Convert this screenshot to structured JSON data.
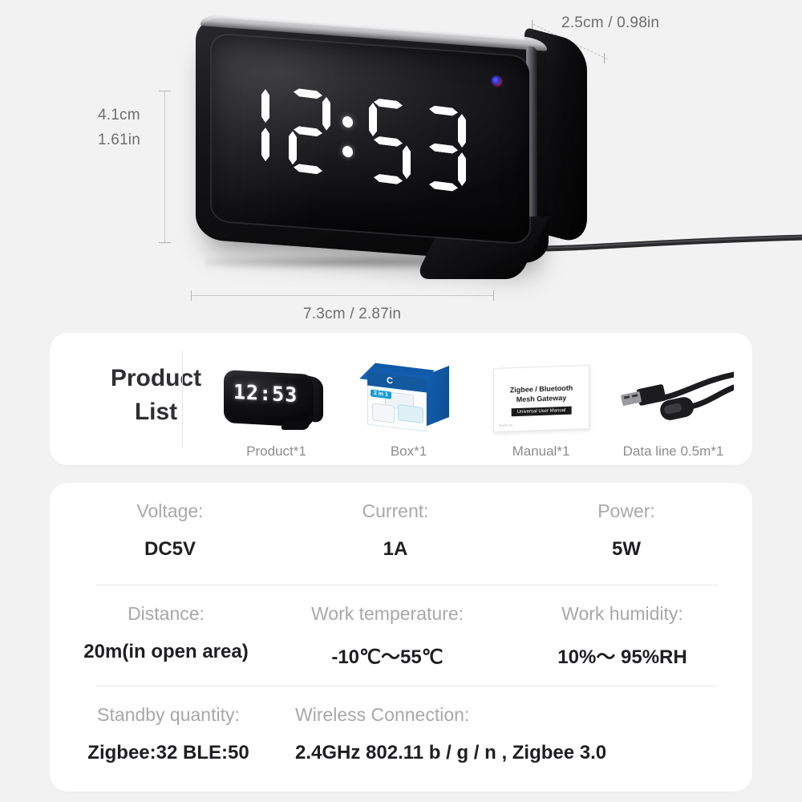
{
  "dimensions": {
    "height_label": "4.1cm",
    "height_label_in": "1.61in",
    "depth_label": "2.5cm / 0.98in",
    "width_label": "7.3cm / 2.87in"
  },
  "device": {
    "time_display": "12:53",
    "time_digits": [
      "1",
      "2",
      "5",
      "3"
    ],
    "led_indicator": "status-led"
  },
  "product_list": {
    "title_line1": "Product",
    "title_line2": "List",
    "items": [
      {
        "label": "Product*1",
        "icon": "clock-device-thumb",
        "time": "12:53"
      },
      {
        "label": "Box*1",
        "icon": "retail-box-thumb",
        "badge": "2 in 1",
        "logo": "C"
      },
      {
        "label": "Manual*1",
        "icon": "manual-booklet-thumb",
        "cover_title_line1": "Zigbee / Bluetooth",
        "cover_title_line2": "Mesh Gateway",
        "cover_badge": "Universal User Manual",
        "cover_small": "Model No."
      },
      {
        "label": "Data line 0.5m*1",
        "icon": "usb-cable-thumb"
      }
    ]
  },
  "specs": {
    "rows": [
      {
        "cells": [
          {
            "key": "Voltage:",
            "value": "DC5V"
          },
          {
            "key": "Current:",
            "value": "1A"
          },
          {
            "key": "Power:",
            "value": "5W"
          }
        ]
      },
      {
        "cells": [
          {
            "key": "Distance:",
            "value": "20m(in open area)"
          },
          {
            "key": "Work temperature:",
            "value": "-10℃～55℃"
          },
          {
            "key": "Work humidity:",
            "value": "10%～ 95%RH"
          }
        ]
      },
      {
        "cells": [
          {
            "key": "Standby quantity:",
            "value": "Zigbee:32 BLE:50"
          },
          {
            "key": "Wireless Connection:",
            "value": "2.4GHz 802.11 b / g / n , Zigbee 3.0"
          }
        ]
      }
    ]
  },
  "colors": {
    "background": "#f2f2f2",
    "card": "#ffffff",
    "key_text": "#a8a8a8",
    "value_text": "#1f1f22",
    "dimension_text": "#6e6e6e",
    "box_blue": "#13599f"
  }
}
